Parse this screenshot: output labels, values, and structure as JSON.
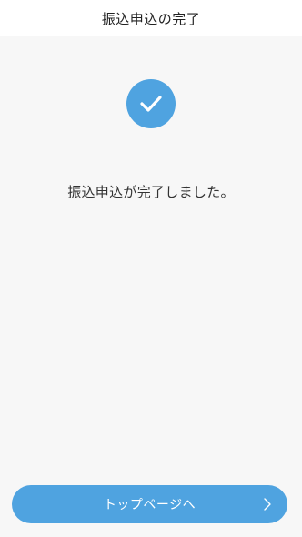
{
  "header": {
    "title": "振込申込の完了"
  },
  "status": {
    "icon": "check-circle-icon",
    "message": "振込申込が完了しました。"
  },
  "actions": {
    "top_page_label": "トップページへ",
    "top_page_icon": "chevron-right-icon"
  },
  "colors": {
    "accent": "#4fa3e0",
    "background": "#f7f7f7",
    "header_background": "#ffffff"
  }
}
